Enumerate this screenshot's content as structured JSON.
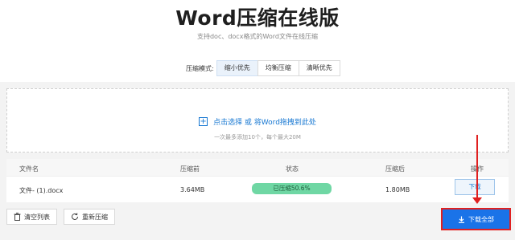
{
  "header": {
    "title": "Word压缩在线版",
    "subtitle": "支持doc、docx格式的Word文件在线压缩"
  },
  "mode": {
    "label": "压缩模式:",
    "options": [
      "缩小优先",
      "均衡压缩",
      "清晰优先"
    ],
    "selected": "缩小优先"
  },
  "dropzone": {
    "main_text": "点击选择 或 将Word拖拽到此处",
    "sub_text": "一次最多添加10个，每个最大20M"
  },
  "table": {
    "headers": [
      "文件名",
      "压缩前",
      "状态",
      "压缩后",
      "操作"
    ],
    "rows": [
      {
        "filename": "文件- (1).docx",
        "before": "3.64MB",
        "status": "已压缩50.6%",
        "after": "1.80MB",
        "action": "下载"
      }
    ]
  },
  "footer": {
    "clear_label": "清空列表",
    "recompress_label": "重新压缩",
    "download_all_label": "下载全部"
  },
  "colors": {
    "accent": "#1a73e8",
    "status_green": "#6fd7a4",
    "annotation_red": "#e02020"
  }
}
